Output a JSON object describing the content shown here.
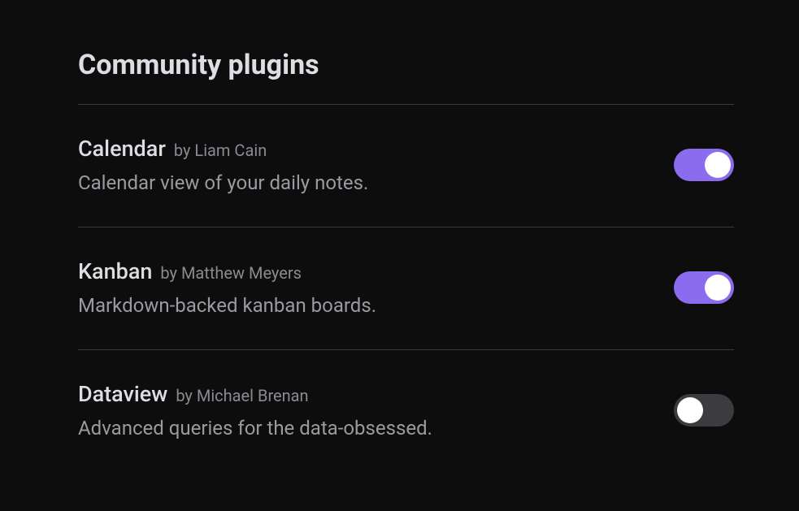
{
  "title": "Community plugins",
  "author_prefix": "by ",
  "plugins": [
    {
      "name": "Calendar",
      "author": "Liam Cain",
      "description": "Calendar view of your daily notes.",
      "enabled": true
    },
    {
      "name": "Kanban",
      "author": "Matthew Meyers",
      "description": "Markdown-backed kanban boards.",
      "enabled": true
    },
    {
      "name": "Dataview",
      "author": "Michael Brenan",
      "description": "Advanced queries for the data-obsessed.",
      "enabled": false
    }
  ],
  "colors": {
    "accent": "#8b6cef",
    "bg": "#0d0d0d",
    "text": "#dddde3",
    "muted": "#9a9aa2"
  }
}
